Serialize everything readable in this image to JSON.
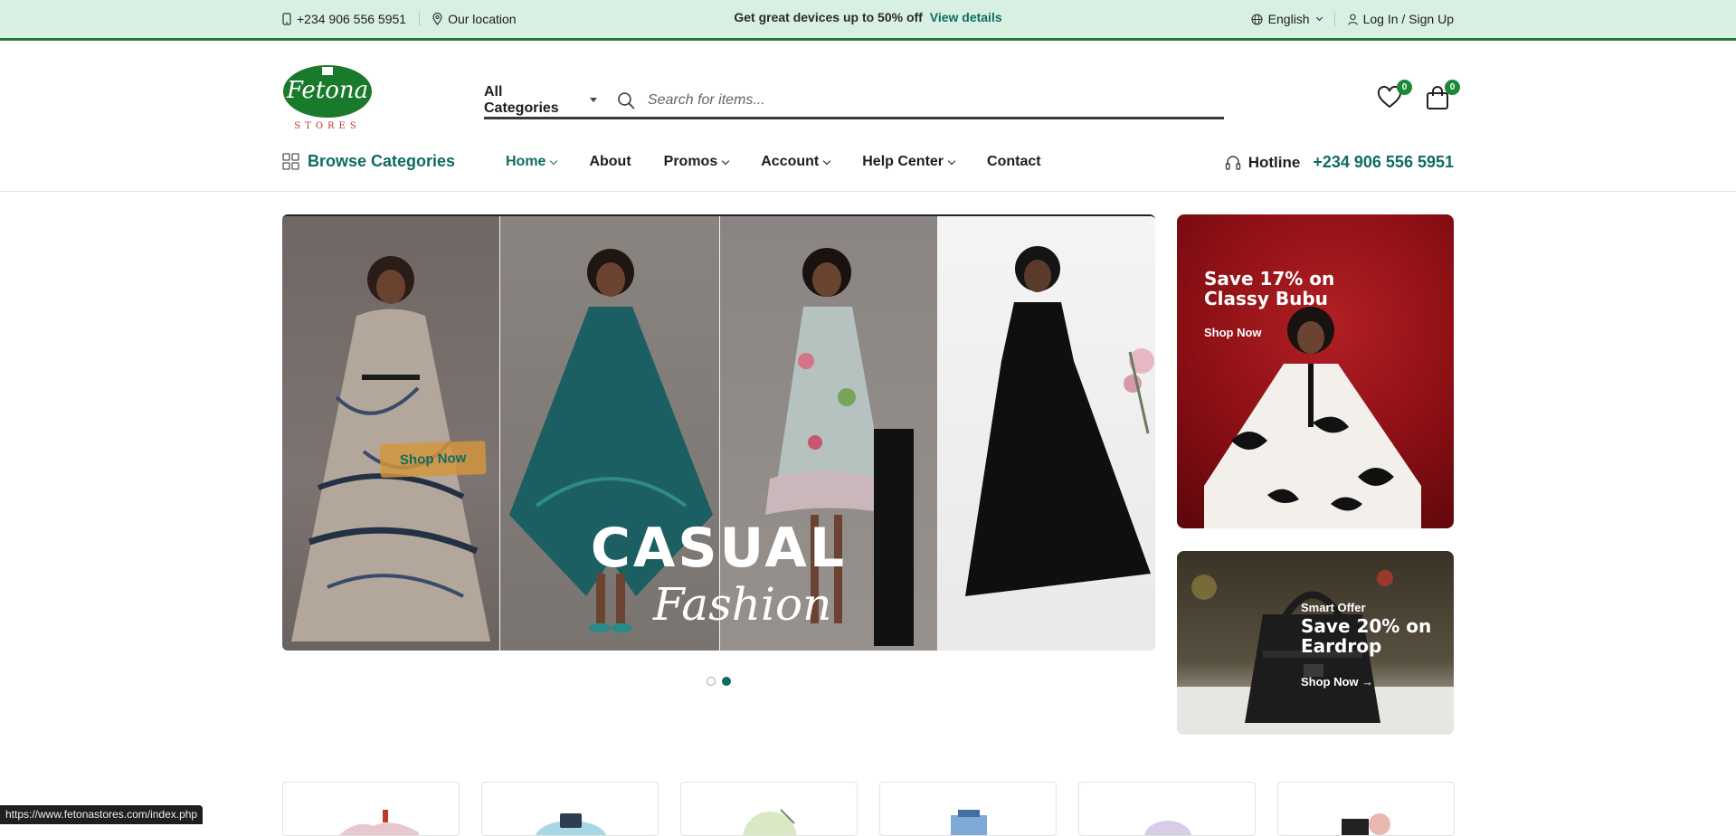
{
  "topbar": {
    "phone": "+234 906 556 5951",
    "location": "Our location",
    "promo_text": "Get great devices up to 50% off",
    "promo_link": "View details",
    "language": "English",
    "auth": "Log In / Sign Up"
  },
  "header": {
    "logo_text": "Fetona",
    "logo_subtext": "STORES",
    "category_select": "All Categories",
    "search_placeholder": "Search for items...",
    "wishlist_count": "0",
    "cart_count": "0"
  },
  "nav": {
    "browse_label": "Browse Categories",
    "items": [
      {
        "label": "Home",
        "dropdown": true,
        "active": true
      },
      {
        "label": "About",
        "dropdown": false,
        "active": false
      },
      {
        "label": "Promos",
        "dropdown": true,
        "active": false
      },
      {
        "label": "Account",
        "dropdown": true,
        "active": false
      },
      {
        "label": "Help Center",
        "dropdown": true,
        "active": false
      },
      {
        "label": "Contact",
        "dropdown": false,
        "active": false
      }
    ],
    "hotline_label": "Hotline",
    "hotline_number": "+234 906 556 5951"
  },
  "hero": {
    "title": "CASUAL",
    "subtitle": "Fashion",
    "cta": "Shop Now",
    "slide_count": 2,
    "active_slide": 2
  },
  "banners": {
    "top": {
      "title_line1": "Save 17% on",
      "title_line2": "Classy Bubu",
      "cta": "Shop Now"
    },
    "bottom": {
      "tag": "Smart Offer",
      "title_line1": "Save 20% on",
      "title_line2": "Eardrop",
      "cta": "Shop Now →"
    }
  },
  "status_url": "https://www.fetonastores.com/index.php",
  "colors": {
    "brand_green": "#1f7a3a",
    "accent_teal": "#0e6c63",
    "topbar_bg": "#d8f0e2"
  }
}
